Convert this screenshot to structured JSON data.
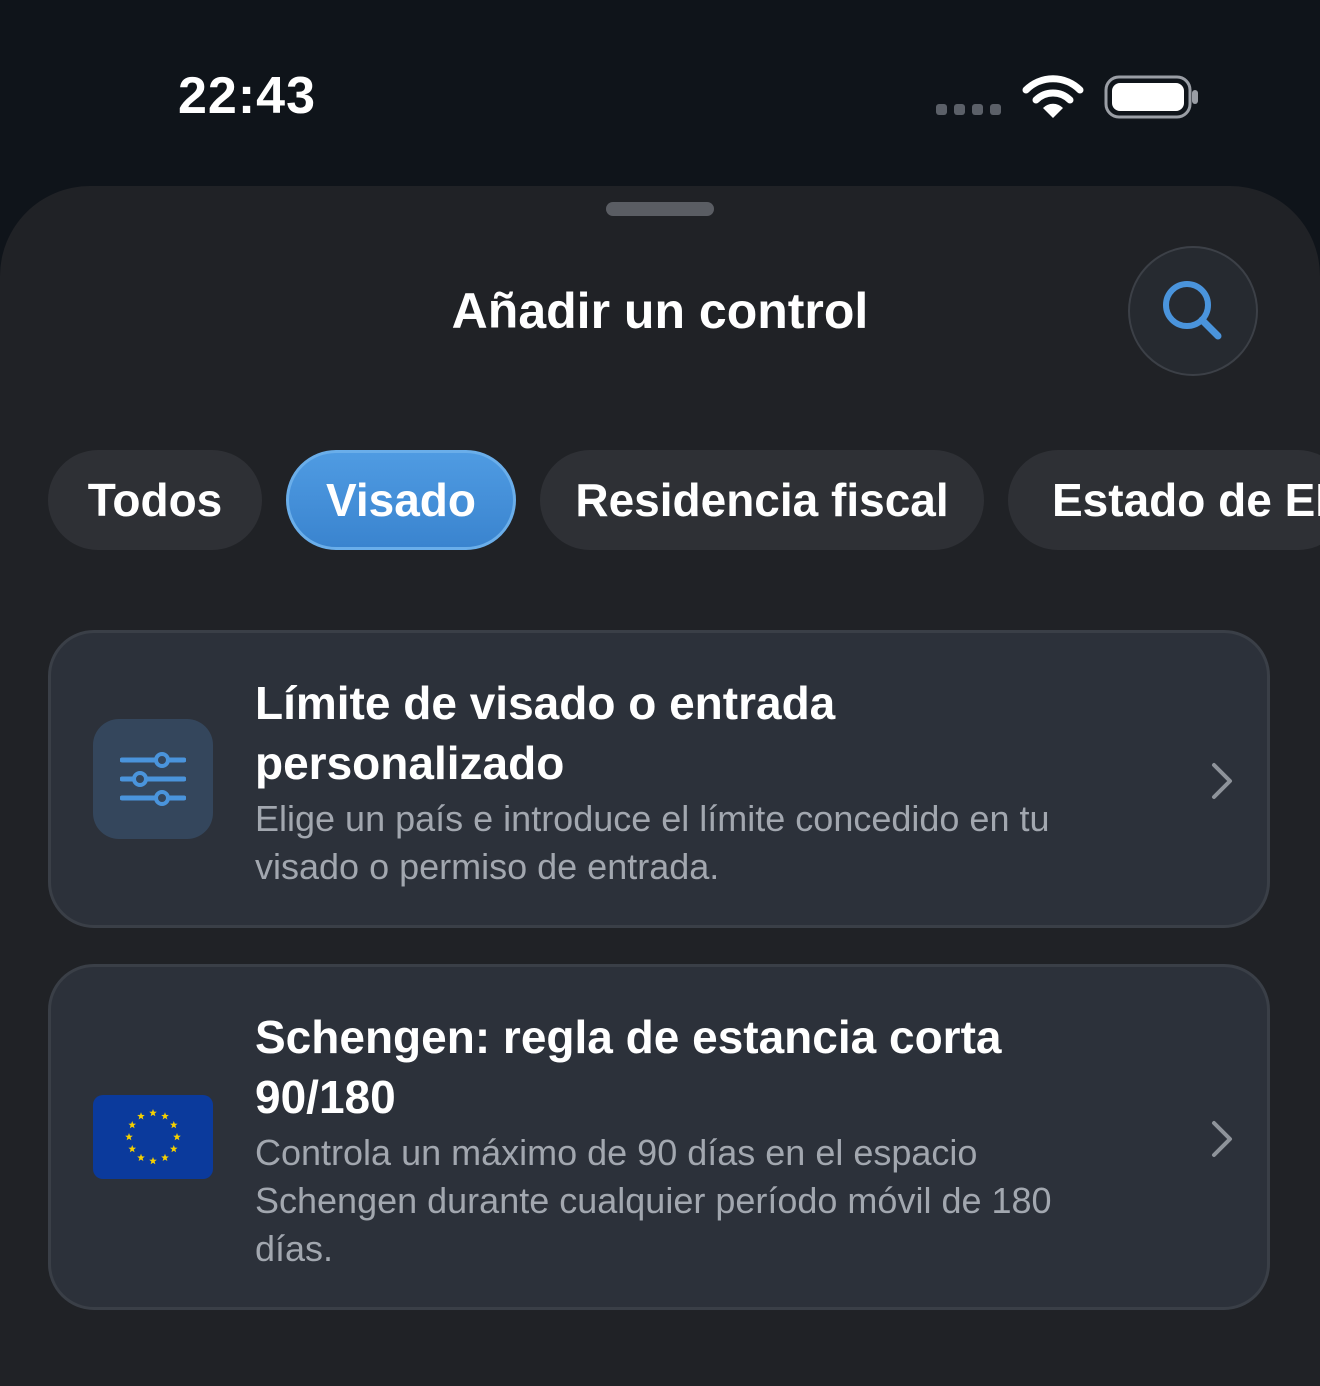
{
  "status_bar": {
    "time": "22:43",
    "icons": [
      "cellular-signal-icon",
      "wifi-icon",
      "battery-icon"
    ]
  },
  "sheet": {
    "title": "Añadir un control",
    "search_icon": "search-icon"
  },
  "tabs": [
    {
      "label": "Todos",
      "active": false
    },
    {
      "label": "Visado",
      "active": true
    },
    {
      "label": "Residencia fiscal",
      "active": false
    },
    {
      "label": "Estado de EE",
      "active": false
    }
  ],
  "cards": [
    {
      "icon": "sliders-icon",
      "title": "Límite de visado o entrada personalizado",
      "description": "Elige un país e introduce el límite concedido en tu visado o permiso de entrada."
    },
    {
      "icon": "eu-flag-icon",
      "title": "Schengen: regla de estancia corta 90/180",
      "description": "Controla un máximo de 90 días en el espacio Schengen durante cualquier período móvil de 180 días."
    }
  ],
  "colors": {
    "background": "#0f141a",
    "sheet": "#202226",
    "accent": "#4a94dc",
    "card": "#2c313a",
    "eu_blue": "#0b3a9c",
    "eu_star": "#f5d000"
  }
}
